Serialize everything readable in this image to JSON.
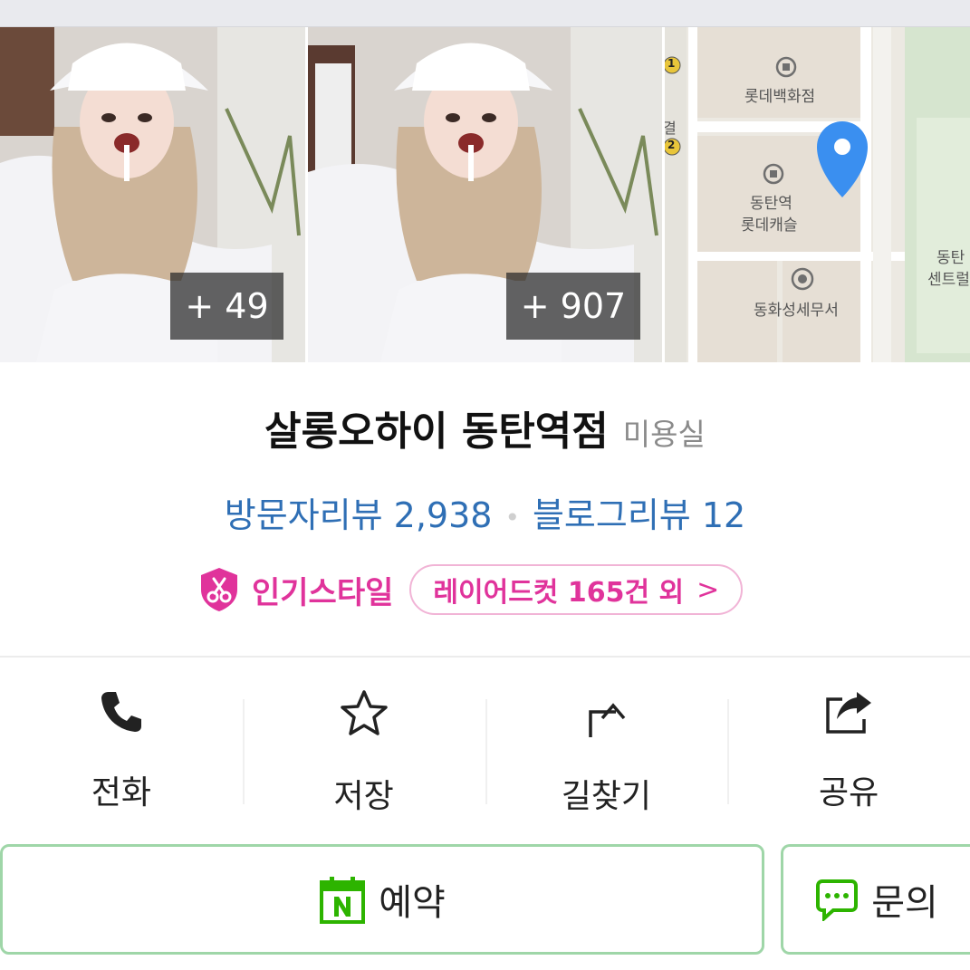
{
  "gallery": {
    "photos": [
      {
        "count_label": "+ 49"
      },
      {
        "count_label": "+ 907"
      }
    ],
    "map": {
      "labels": [
        "롯데백화점",
        "동탄역",
        "롯데캐슬",
        "동탄",
        "센트럴",
        "동화성세무서",
        "결"
      ],
      "markers": [
        "1",
        "2"
      ],
      "pin_color": "#3a8ff0"
    }
  },
  "place": {
    "name": "살롱오하이 동탄역점",
    "category": "미용실"
  },
  "reviews": {
    "visitor": "방문자리뷰 2,938",
    "separator": "•",
    "blog": "블로그리뷰 12"
  },
  "popular_style": {
    "label": "인기스타일",
    "chip": "레이어드컷 165건 외",
    "chevron": ">",
    "accent": "#e0339b"
  },
  "actions": [
    {
      "label": "전화",
      "icon": "phone-icon"
    },
    {
      "label": "저장",
      "icon": "star-icon"
    },
    {
      "label": "길찾기",
      "icon": "directions-icon"
    },
    {
      "label": "공유",
      "icon": "share-icon"
    }
  ],
  "buttons": {
    "reserve": {
      "label": "예약",
      "icon": "naver-calendar-icon"
    },
    "inquiry": {
      "label": "문의",
      "icon": "chat-icon"
    },
    "border_color": "#9fd6a8"
  }
}
